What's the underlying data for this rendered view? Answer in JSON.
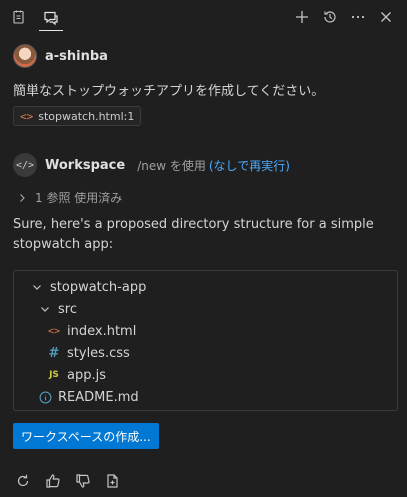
{
  "user": {
    "name": "a-shinba"
  },
  "request": {
    "text": "簡単なストップウォッチアプリを作成してください。"
  },
  "reference_chip": {
    "icon": "<>",
    "label": "stopwatch.html:1"
  },
  "agent": {
    "icon": "</>",
    "name": "Workspace",
    "command": "/new を使用",
    "rerun_link": "(なしで再実行)"
  },
  "references": {
    "label": "1 参照 使用済み"
  },
  "reply": {
    "text": "Sure, here's a proposed directory structure for a simple stopwatch app:"
  },
  "file_tree": [
    {
      "name": "stopwatch-app",
      "icon": "chevron-down-icon",
      "depth": 0
    },
    {
      "name": "src",
      "icon": "chevron-down-icon",
      "depth": 1
    },
    {
      "name": "index.html",
      "icon": "html-file-icon",
      "depth": 2
    },
    {
      "name": "styles.css",
      "icon": "css-file-icon",
      "depth": 2
    },
    {
      "name": "app.js",
      "icon": "js-file-icon",
      "depth": 2
    },
    {
      "name": "README.md",
      "icon": "info-icon",
      "depth": 1
    }
  ],
  "js_badge": "JS",
  "css_badge": "#",
  "create_workspace_button": {
    "label": "ワークスペースの作成..."
  },
  "colors": {
    "accent": "#0078d4",
    "link": "#4daafc",
    "html": "#e07a52",
    "css": "#519aba",
    "js": "#cbcb41"
  }
}
